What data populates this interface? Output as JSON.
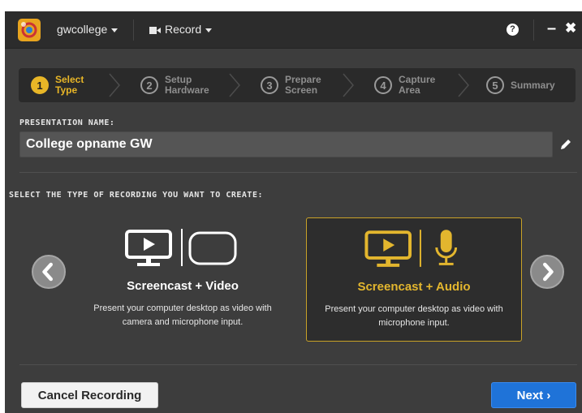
{
  "titlebar": {
    "account": "gwcollege",
    "record_menu": "Record",
    "help": "?",
    "minimize": "–",
    "close": "✖"
  },
  "steps": [
    {
      "num": "1",
      "label": "Select\nType",
      "active": true
    },
    {
      "num": "2",
      "label": "Setup\nHardware",
      "active": false
    },
    {
      "num": "3",
      "label": "Prepare\nScreen",
      "active": false
    },
    {
      "num": "4",
      "label": "Capture\nArea",
      "active": false
    },
    {
      "num": "5",
      "label": "Summary",
      "active": false
    }
  ],
  "presentation": {
    "label": "PRESENTATION NAME:",
    "value": "College opname GW"
  },
  "recording": {
    "label": "SELECT THE TYPE OF RECORDING YOU WANT TO CREATE:",
    "options": [
      {
        "title": "Screencast + Video",
        "desc": "Present your computer desktop as video with camera and microphone input.",
        "selected": false
      },
      {
        "title": "Screencast + Audio",
        "desc": "Present your computer desktop as video with microphone input.",
        "selected": true
      }
    ]
  },
  "footer": {
    "cancel_label": "Cancel Recording",
    "next_label": "Next ›"
  },
  "colors": {
    "accent": "#e8b627",
    "primary_button": "#1f73d8",
    "background": "#3d3d3d",
    "titlebar": "#2c2c2c"
  }
}
